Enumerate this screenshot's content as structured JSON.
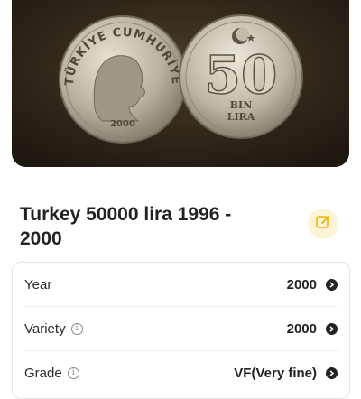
{
  "coin": {
    "obverse_legend": "TÜRKİYE CUMHURİYETİ",
    "obverse_year": "2000",
    "reverse_value": "50",
    "reverse_bin": "BIN",
    "reverse_lira": "LIRA"
  },
  "title": "Turkey 50000 lira 1996 - 2000",
  "details": [
    {
      "label": "Year",
      "value": "2000",
      "has_info": false
    },
    {
      "label": "Variety",
      "value": "2000",
      "has_info": true
    },
    {
      "label": "Grade",
      "value": "VF(Very fine)",
      "has_info": true
    }
  ],
  "colors": {
    "accent": "#f2b400",
    "accent_bg": "#fdf4d8",
    "photo_bg": "#2c2418"
  },
  "icons": {
    "edit": "edit-icon",
    "info": "info-icon",
    "chevron": "chevron-right-icon"
  }
}
